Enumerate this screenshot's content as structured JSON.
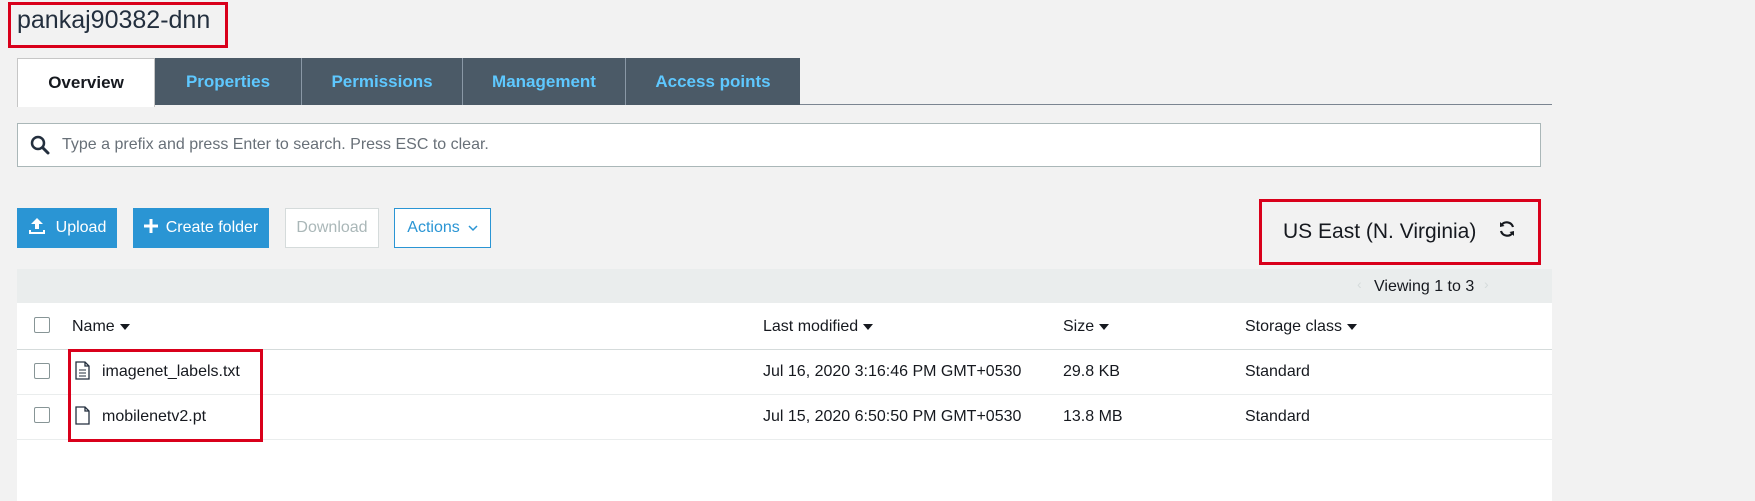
{
  "bucket": {
    "name": "pankaj90382-dnn"
  },
  "tabs": [
    {
      "label": "Overview"
    },
    {
      "label": "Properties"
    },
    {
      "label": "Permissions"
    },
    {
      "label": "Management"
    },
    {
      "label": "Access points"
    }
  ],
  "search": {
    "placeholder": "Type a prefix and press Enter to search. Press ESC to clear."
  },
  "toolbar": {
    "upload_label": "Upload",
    "create_folder_label": "Create folder",
    "download_label": "Download",
    "actions_label": "Actions"
  },
  "region": {
    "label": "US East (N. Virginia)"
  },
  "pagination": {
    "viewing": "Viewing 1 to 3"
  },
  "table": {
    "columns": [
      "Name",
      "Last modified",
      "Size",
      "Storage class"
    ],
    "rows": [
      {
        "name": "imagenet_labels.txt",
        "modified": "Jul 16, 2020 3:16:46 PM GMT+0530",
        "size": "29.8 KB",
        "storage": "Standard",
        "icon": "text-file-icon"
      },
      {
        "name": "mobilenetv2.pt",
        "modified": "Jul 15, 2020 6:50:50 PM GMT+0530",
        "size": "13.8 MB",
        "storage": "Standard",
        "icon": "file-icon"
      }
    ]
  },
  "colors": {
    "accent": "#2a95d4",
    "highlight": "#d9001b",
    "tab_bg": "#4b5a67",
    "tab_text": "#5ec8ff"
  }
}
